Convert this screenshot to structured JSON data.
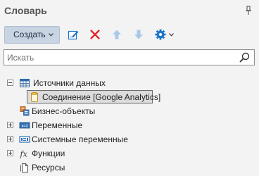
{
  "panel": {
    "title": "Словарь"
  },
  "toolbar": {
    "create_label": "Создать",
    "items": [
      "edit-icon",
      "delete-icon",
      "move-up-icon",
      "move-down-icon",
      "settings-icon"
    ]
  },
  "search": {
    "placeholder": "Искать",
    "value": ""
  },
  "tree": {
    "items": [
      {
        "label": "Источники данных",
        "icon": "table-icon",
        "expander": "collapse"
      },
      {
        "label": "Соединение [Google Analytics]",
        "icon": "connection-icon",
        "selected": true
      },
      {
        "label": "Бизнес-объекты",
        "icon": "business-objects-icon"
      },
      {
        "label": "Переменные",
        "icon": "variables-icon",
        "expander": "expand"
      },
      {
        "label": "Системные переменные",
        "icon": "system-variables-icon",
        "expander": "expand"
      },
      {
        "label": "Функции",
        "icon": "function-icon",
        "expander": "expand"
      },
      {
        "label": "Ресурсы",
        "icon": "resources-icon"
      }
    ]
  },
  "colors": {
    "accent": "#1a73c8",
    "delete": "#e0262b",
    "disabled_arrow": "#a8c8e8",
    "selection_bg": "#dcdcdc"
  }
}
